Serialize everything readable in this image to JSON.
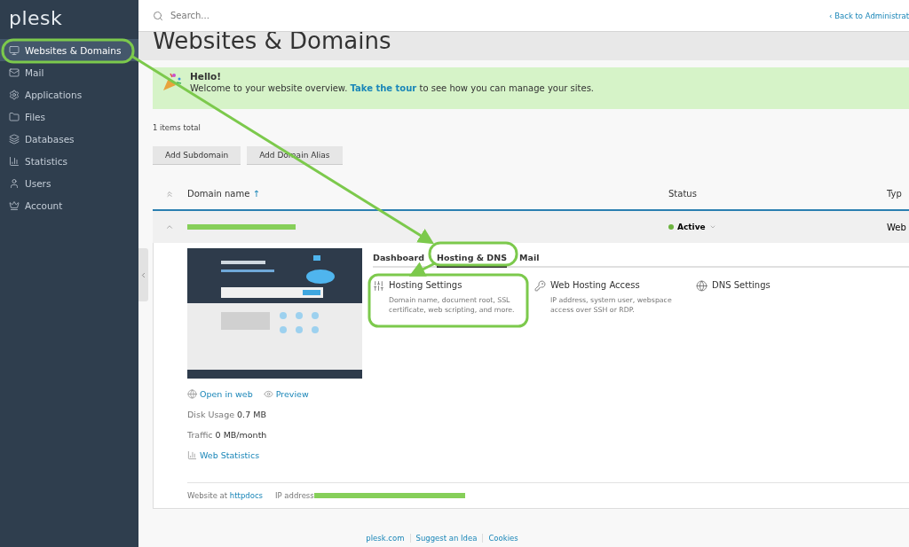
{
  "brand": "plesk",
  "sidebar": {
    "items": [
      {
        "label": "Websites & Domains",
        "selected": true
      },
      {
        "label": "Mail",
        "selected": false
      },
      {
        "label": "Applications",
        "selected": false
      },
      {
        "label": "Files",
        "selected": false
      },
      {
        "label": "Databases",
        "selected": false
      },
      {
        "label": "Statistics",
        "selected": false
      },
      {
        "label": "Users",
        "selected": false
      },
      {
        "label": "Account",
        "selected": false
      }
    ]
  },
  "header": {
    "search_placeholder": "Search...",
    "back_arrow": "‹",
    "back_link": "Back to Administrat"
  },
  "page_title": "Websites & Domains",
  "banner": {
    "title": "Hello!",
    "text_before": "Welcome to your website overview.",
    "link": "Take the tour",
    "text_after": "to see how you can manage your sites."
  },
  "items_total": "1 items total",
  "buttons": [
    "Add Subdomain",
    "Add Domain Alias"
  ],
  "table": {
    "columns": [
      {
        "label": "Domain name",
        "sort_mark": "↑"
      },
      {
        "label": "Status"
      },
      {
        "label": "Typ"
      }
    ],
    "row": {
      "expanded": true,
      "status": "Active",
      "type": "Web",
      "tabs": [
        {
          "label": "Dashboard",
          "selected": false
        },
        {
          "label": "Hosting & DNS",
          "selected": true
        },
        {
          "label": "Mail",
          "selected": false
        }
      ],
      "tools": [
        {
          "title": "Hosting Settings",
          "description": "Domain name, document root, SSL certificate, web scripting, and more."
        },
        {
          "title": "Web Hosting Access",
          "description": "IP address, system user, webspace access over SSH or RDP."
        },
        {
          "title": "DNS Settings"
        }
      ],
      "links": [
        {
          "label": "Open in web"
        },
        {
          "label": "Preview"
        }
      ],
      "disk_usage": {
        "label": "Disk Usage",
        "value": "0.7 MB"
      },
      "traffic": {
        "label": "Traffic",
        "value": "0 MB/month"
      },
      "stats_link": "Web Statistics",
      "website_at": {
        "label": "Website at",
        "link": "httpdocs"
      },
      "ip_label": "IP address"
    }
  },
  "footer": [
    "plesk.com",
    "Suggest an Idea",
    "Cookies"
  ]
}
